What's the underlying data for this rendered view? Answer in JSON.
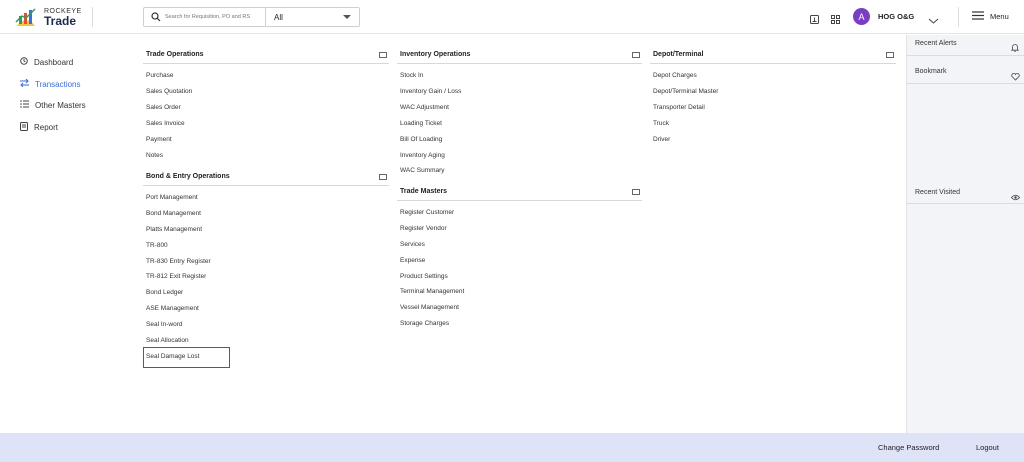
{
  "brand": {
    "sub": "ROCKEYE",
    "main": "Trade"
  },
  "search": {
    "placeholder": "Search for Requisition, PO and RS",
    "select_value": "All"
  },
  "user": {
    "initial": "A",
    "name": "HOG O&G"
  },
  "menu_label": "Menu",
  "sidebar": {
    "items": [
      {
        "label": "Dashboard",
        "icon": "clock-icon"
      },
      {
        "label": "Transactions",
        "icon": "swap-icon"
      },
      {
        "label": "Other Masters",
        "icon": "list-icon"
      },
      {
        "label": "Report",
        "icon": "document-icon"
      }
    ],
    "active": "Transactions"
  },
  "sections": {
    "trade_operations": {
      "title": "Trade Operations",
      "items": [
        "Purchase",
        "Sales Quotation",
        "Sales Order",
        "Sales Invoice",
        "Payment",
        "Notes"
      ]
    },
    "bond_entry": {
      "title": "Bond & Entry Operations",
      "items": [
        "Port Management",
        "Bond Management",
        "Platts Management",
        "TR-800",
        "TR-830 Entry Register",
        "TR-812 Exit Register",
        "Bond Ledger",
        "ASE Management",
        "Seal In-word",
        "Seal Allocation",
        "Seal Damage Lost"
      ]
    },
    "inventory_operations": {
      "title": "Inventory Operations",
      "items": [
        "Stock In",
        "Inventory Gain / Loss",
        "WAC Adjustment",
        "Loading Ticket",
        "Bill Of Loading",
        "Inventory Aging",
        "WAC Summary"
      ]
    },
    "trade_masters": {
      "title": "Trade Masters",
      "items": [
        "Register Customer",
        "Register Vendor",
        "Services",
        "Expense",
        "Product Settings",
        "Terminal Management",
        "Vessel Management",
        "Storage Charges"
      ]
    },
    "depot_terminal": {
      "title": "Depot/Terminal",
      "items": [
        "Depot Charges",
        "Depot/Terminal Master",
        "Transporter Detail",
        "Truck",
        "Driver"
      ]
    }
  },
  "right_panel": {
    "recent_alerts": "Recent Alerts",
    "bookmark": "Bookmark",
    "recent_visited": "Recent Visited"
  },
  "footer": {
    "change_password": "Change Password",
    "logout": "Logout"
  },
  "colors": {
    "accent": "#3a6ed8",
    "footer_bg": "#dfe3f8",
    "highlight": "#e0202a",
    "avatar": "#7a3fc1"
  }
}
